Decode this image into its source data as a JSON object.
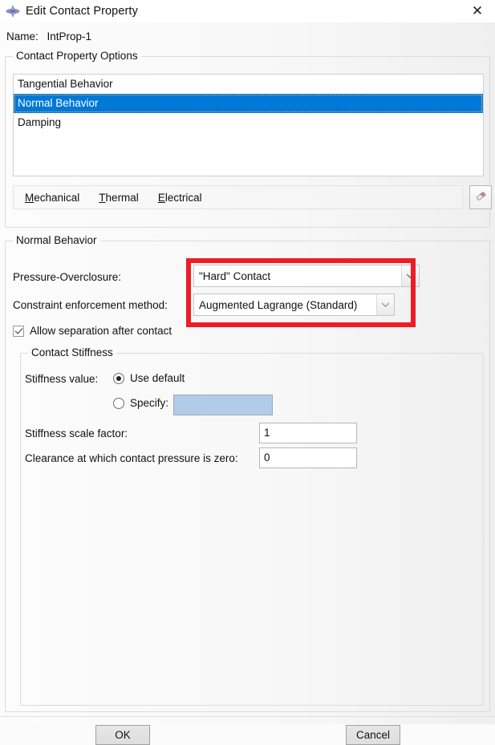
{
  "window": {
    "title": "Edit Contact Property",
    "icon": "abaqus-diamond-icon",
    "close_label": "✕"
  },
  "name_field": {
    "label": "Name:",
    "value": "IntProp-1"
  },
  "options_group": {
    "title": "Contact Property Options",
    "items": [
      {
        "label": "Tangential Behavior",
        "selected": false
      },
      {
        "label": "Normal Behavior",
        "selected": true
      },
      {
        "label": "Damping",
        "selected": false
      }
    ],
    "menu": [
      {
        "mnemonic": "M",
        "rest": "echanical"
      },
      {
        "mnemonic": "T",
        "rest": "hermal"
      },
      {
        "mnemonic": "E",
        "rest": "lectrical"
      }
    ],
    "delete_button": "eraser-icon"
  },
  "normal_behavior": {
    "title": "Normal Behavior",
    "pressure_overclosure": {
      "label": "Pressure-Overclosure:",
      "value": "\"Hard\" Contact"
    },
    "constraint_enforcement": {
      "label": "Constraint enforcement method:",
      "value": "Augmented Lagrange (Standard)"
    },
    "allow_separation": {
      "label": "Allow separation after contact",
      "checked": true
    },
    "stiffness_group": {
      "title": "Contact Stiffness",
      "stiffness_value_label": "Stiffness value:",
      "use_default_label": "Use default",
      "use_default_selected": true,
      "specify_label": "Specify:",
      "specify_selected": false,
      "specify_value": "",
      "scale_factor_label": "Stiffness scale factor:",
      "scale_factor_value": "1",
      "clearance_label": "Clearance at which contact pressure is zero:",
      "clearance_value": "0"
    }
  },
  "annotation": {
    "color": "#ee1c25"
  },
  "footer": {
    "ok_label": "OK",
    "cancel_label": "Cancel"
  }
}
